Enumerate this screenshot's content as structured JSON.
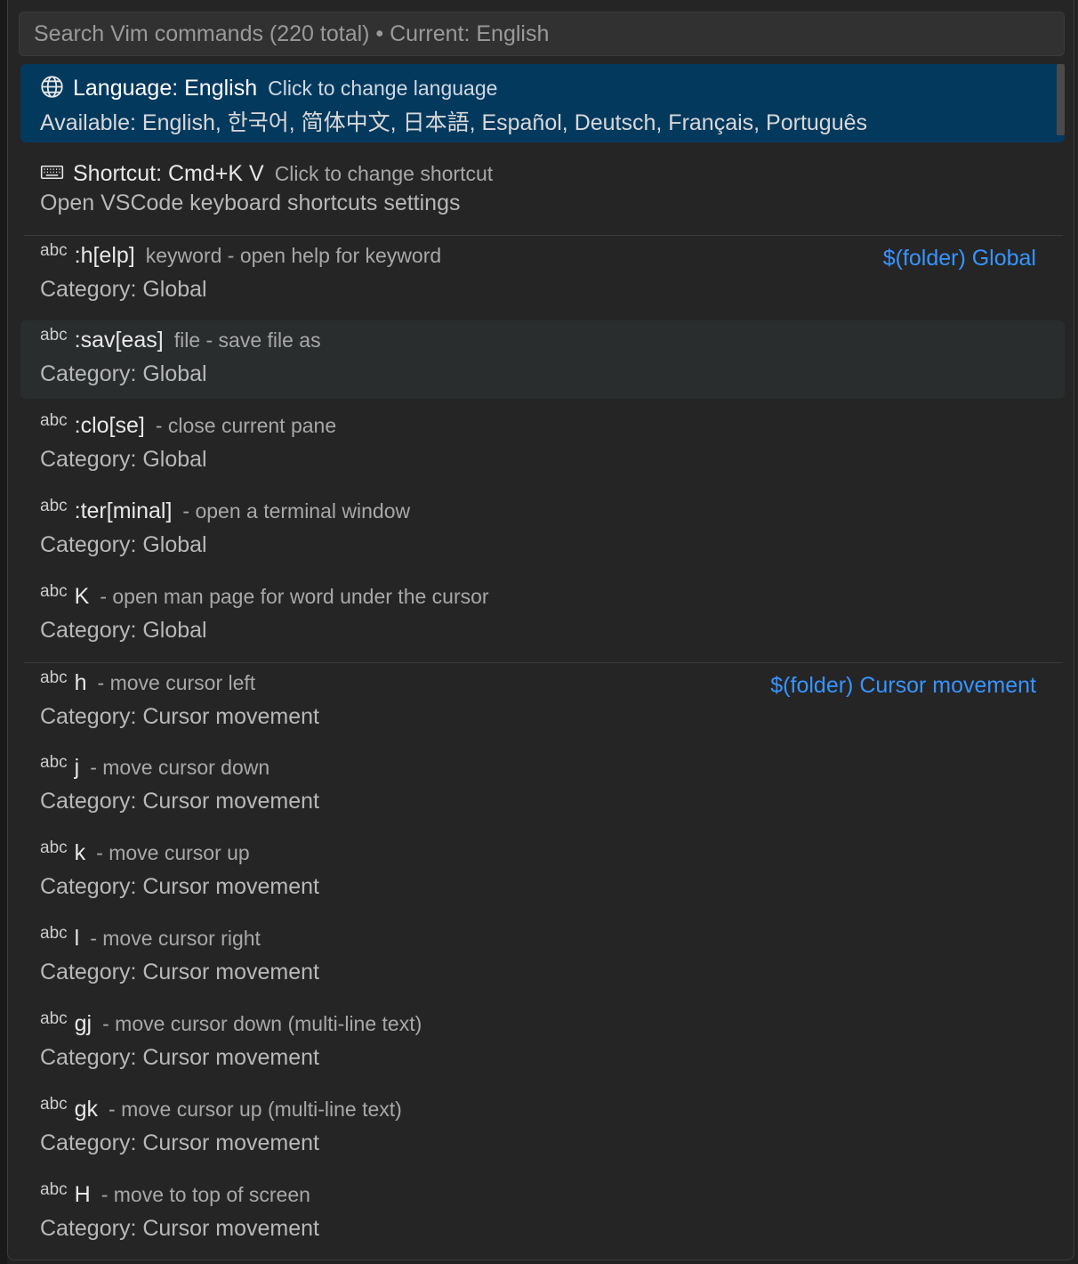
{
  "search": {
    "placeholder": "Search Vim commands (220 total) • Current: English"
  },
  "items": [
    {
      "icon": "globe-icon",
      "title": "Language: English",
      "desc": "Click to change language",
      "sub": "Available: English, 한국어, 简体中文, 日本語, Español, Deutsch, Français, Português"
    },
    {
      "icon": "keyboard-icon",
      "title": "Shortcut: Cmd+K V",
      "desc": "Click to change shortcut",
      "sub": "Open VSCode keyboard shortcuts settings"
    }
  ],
  "commands": [
    {
      "abc": "abc",
      "cmd": ":h[elp]",
      "desc": "keyword - open help for keyword",
      "sub": "Category: Global",
      "group": "$(folder) Global"
    },
    {
      "abc": "abc",
      "cmd": ":sav[eas]",
      "desc": "file - save file as",
      "sub": "Category: Global"
    },
    {
      "abc": "abc",
      "cmd": ":clo[se]",
      "desc": "- close current pane",
      "sub": "Category: Global"
    },
    {
      "abc": "abc",
      "cmd": ":ter[minal]",
      "desc": "- open a terminal window",
      "sub": "Category: Global"
    },
    {
      "abc": "abc",
      "cmd": "K",
      "desc": "- open man page for word under the cursor",
      "sub": "Category: Global"
    },
    {
      "abc": "abc",
      "cmd": "h",
      "desc": "- move cursor left",
      "sub": "Category: Cursor movement",
      "group": "$(folder) Cursor movement"
    },
    {
      "abc": "abc",
      "cmd": "j",
      "desc": "- move cursor down",
      "sub": "Category: Cursor movement"
    },
    {
      "abc": "abc",
      "cmd": "k",
      "desc": "- move cursor up",
      "sub": "Category: Cursor movement"
    },
    {
      "abc": "abc",
      "cmd": "l",
      "desc": "- move cursor right",
      "sub": "Category: Cursor movement"
    },
    {
      "abc": "abc",
      "cmd": "gj",
      "desc": "- move cursor down (multi-line text)",
      "sub": "Category: Cursor movement"
    },
    {
      "abc": "abc",
      "cmd": "gk",
      "desc": "- move cursor up (multi-line text)",
      "sub": "Category: Cursor movement"
    },
    {
      "abc": "abc",
      "cmd": "H",
      "desc": "- move to top of screen",
      "sub": "Category: Cursor movement"
    }
  ],
  "colors": {
    "selected_bg": "#04395e",
    "group_label": "#3794ff"
  }
}
